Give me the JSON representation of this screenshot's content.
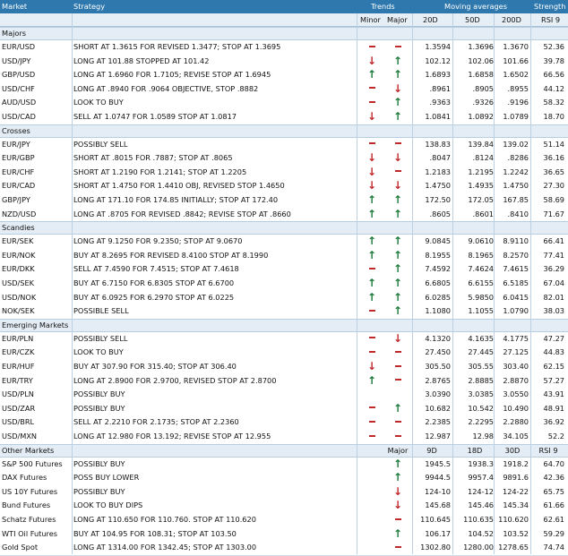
{
  "header": {
    "market": "Market",
    "strategy": "Strategy",
    "trends": "Trends",
    "moving_averages": "Moving averages",
    "strength": "Strength",
    "minor": "Minor",
    "major": "Major",
    "ma1": "20D",
    "ma2": "50D",
    "ma3": "200D",
    "rsi": "RSI 9"
  },
  "colors": {
    "up": "#1a7a3a",
    "down": "#c0292c",
    "header_bg": "#2e78ad",
    "section_bg": "#e4edf5"
  },
  "sections": [
    {
      "name": "Majors",
      "rows": [
        {
          "market": "EUR/USD",
          "strategy": "SHORT AT 1.3615 FOR REVISED 1.3477; STOP AT 1.3695",
          "minor": "flat",
          "major": "flat",
          "v1": "1.3594",
          "v2": "1.3696",
          "v3": "1.3670",
          "rsi": "52.36"
        },
        {
          "market": "USD/JPY",
          "strategy": "LONG AT 101.88 STOPPED AT 101.42",
          "minor": "down",
          "major": "up",
          "v1": "102.12",
          "v2": "102.06",
          "v3": "101.66",
          "rsi": "39.78"
        },
        {
          "market": "GBP/USD",
          "strategy": "LONG AT 1.6960 FOR 1.7105; REVISE STOP AT 1.6945",
          "minor": "up",
          "major": "up",
          "v1": "1.6893",
          "v2": "1.6858",
          "v3": "1.6502",
          "rsi": "66.56"
        },
        {
          "market": "USD/CHF",
          "strategy": "LONG AT .8940 FOR .9064 OBJECTIVE, STOP .8882",
          "minor": "flat",
          "major": "down",
          "v1": ".8961",
          "v2": ".8905",
          "v3": ".8955",
          "rsi": "44.12"
        },
        {
          "market": "AUD/USD",
          "strategy": "LOOK TO BUY",
          "minor": "flat",
          "major": "up",
          "v1": ".9363",
          "v2": ".9326",
          "v3": ".9196",
          "rsi": "58.32"
        },
        {
          "market": "USD/CAD",
          "strategy": "SELL AT 1.0747 FOR 1.0589 STOP AT 1.0817",
          "minor": "down",
          "major": "up",
          "v1": "1.0841",
          "v2": "1.0892",
          "v3": "1.0789",
          "rsi": "18.70"
        }
      ]
    },
    {
      "name": "Crosses",
      "rows": [
        {
          "market": "EUR/JPY",
          "strategy": "POSSIBLY SELL",
          "minor": "flat",
          "major": "flat",
          "v1": "138.83",
          "v2": "139.84",
          "v3": "139.02",
          "rsi": "51.14"
        },
        {
          "market": "EUR/GBP",
          "strategy": "SHORT AT .8015 FOR .7887; STOP AT .8065",
          "minor": "down",
          "major": "down",
          "v1": ".8047",
          "v2": ".8124",
          "v3": ".8286",
          "rsi": "36.16"
        },
        {
          "market": "EUR/CHF",
          "strategy": "SHORT AT 1.2190 FOR 1.2141; STOP AT 1.2205",
          "minor": "down",
          "major": "flat",
          "v1": "1.2183",
          "v2": "1.2195",
          "v3": "1.2242",
          "rsi": "36.65"
        },
        {
          "market": "EUR/CAD",
          "strategy": "SHORT AT 1.4750 FOR 1.4410 OBJ, REVISED STOP 1.4650",
          "minor": "down",
          "major": "down",
          "v1": "1.4750",
          "v2": "1.4935",
          "v3": "1.4750",
          "rsi": "27.30"
        },
        {
          "market": "GBP/JPY",
          "strategy": "LONG AT 171.10 FOR 174.85 INITIALLY; STOP AT 172.40",
          "minor": "up",
          "major": "up",
          "v1": "172.50",
          "v2": "172.05",
          "v3": "167.85",
          "rsi": "58.69"
        },
        {
          "market": "NZD/USD",
          "strategy": "LONG AT .8705 FOR REVISED .8842; REVISE STOP AT .8660",
          "minor": "up",
          "major": "up",
          "v1": ".8605",
          "v2": ".8601",
          "v3": ".8410",
          "rsi": "71.67"
        }
      ]
    },
    {
      "name": "Scandies",
      "rows": [
        {
          "market": "EUR/SEK",
          "strategy": "LONG AT 9.1250 FOR 9.2350; STOP AT 9.0670",
          "minor": "up",
          "major": "up",
          "v1": "9.0845",
          "v2": "9.0610",
          "v3": "8.9110",
          "rsi": "66.41"
        },
        {
          "market": "EUR/NOK",
          "strategy": "BUY AT 8.2695 FOR REVISED 8.4100 STOP AT 8.1990",
          "minor": "up",
          "major": "up",
          "v1": "8.1955",
          "v2": "8.1965",
          "v3": "8.2570",
          "rsi": "77.41"
        },
        {
          "market": "EUR/DKK",
          "strategy": "SELL AT 7.4590 FOR 7.4515; STOP AT 7.4618",
          "minor": "flat",
          "major": "up",
          "v1": "7.4592",
          "v2": "7.4624",
          "v3": "7.4615",
          "rsi": "36.29"
        },
        {
          "market": "USD/SEK",
          "strategy": "BUY AT 6.7150 FOR 6.8305 STOP AT 6.6700",
          "minor": "up",
          "major": "up",
          "v1": "6.6805",
          "v2": "6.6155",
          "v3": "6.5185",
          "rsi": "67.04"
        },
        {
          "market": "USD/NOK",
          "strategy": "BUY AT 6.0925 FOR 6.2970 STOP AT 6.0225",
          "minor": "up",
          "major": "up",
          "v1": "6.0285",
          "v2": "5.9850",
          "v3": "6.0415",
          "rsi": "82.01"
        },
        {
          "market": "NOK/SEK",
          "strategy": "POSSIBLE SELL",
          "minor": "flat",
          "major": "up",
          "v1": "1.1080",
          "v2": "1.1055",
          "v3": "1.0790",
          "rsi": "38.03"
        }
      ]
    },
    {
      "name": "Emerging Markets",
      "rows": [
        {
          "market": "EUR/PLN",
          "strategy": "POSSIBLY SELL",
          "minor": "flat",
          "major": "down",
          "v1": "4.1320",
          "v2": "4.1635",
          "v3": "4.1775",
          "rsi": "47.27"
        },
        {
          "market": "EUR/CZK",
          "strategy": "LOOK TO BUY",
          "minor": "flat",
          "major": "flat",
          "v1": "27.450",
          "v2": "27.445",
          "v3": "27.125",
          "rsi": "44.83"
        },
        {
          "market": "EUR/HUF",
          "strategy": "BUY AT 307.90 FOR 315.40; STOP AT 306.40",
          "minor": "down",
          "major": "flat",
          "v1": "305.50",
          "v2": "305.55",
          "v3": "303.40",
          "rsi": "62.15"
        },
        {
          "market": "EUR/TRY",
          "strategy": "LONG AT 2.8900 FOR 2.9700, REVISED STOP AT 2.8700",
          "minor": "up",
          "major": "flat",
          "v1": "2.8765",
          "v2": "2.8885",
          "v3": "2.8870",
          "rsi": "57.27"
        },
        {
          "market": "USD/PLN",
          "strategy": "POSSIBLY BUY",
          "minor": "",
          "major": "",
          "v1": "3.0390",
          "v2": "3.0385",
          "v3": "3.0550",
          "rsi": "43.91"
        },
        {
          "market": "USD/ZAR",
          "strategy": "POSSIBLY BUY",
          "minor": "flat",
          "major": "up",
          "v1": "10.682",
          "v2": "10.542",
          "v3": "10.490",
          "rsi": "48.91"
        },
        {
          "market": "USD/BRL",
          "strategy": "SELL AT 2.2210 FOR 2.1735; STOP AT 2.2360",
          "minor": "flat",
          "major": "flat",
          "v1": "2.2385",
          "v2": "2.2295",
          "v3": "2.2880",
          "rsi": "36.92"
        },
        {
          "market": "USD/MXN",
          "strategy": "LONG AT 12.980 FOR 13.192; REVISE STOP AT 12.955",
          "minor": "flat",
          "major": "flat",
          "v1": "12.987",
          "v2": "12.98",
          "v3": "34.105",
          "rsi": "52.2"
        }
      ]
    },
    {
      "name": "Other Markets",
      "header": {
        "major": "Major",
        "ma1": "9D",
        "ma2": "18D",
        "ma3": "30D",
        "rsi": "RSI 9"
      },
      "rows": [
        {
          "market": "S&P 500 Futures",
          "strategy": "POSSIBLY BUY",
          "minor": "",
          "major": "up",
          "v1": "1945.5",
          "v2": "1938.3",
          "v3": "1918.2",
          "rsi": "64.70"
        },
        {
          "market": "DAX Futures",
          "strategy": "POSS BUY LOWER",
          "minor": "",
          "major": "up",
          "v1": "9944.5",
          "v2": "9957.4",
          "v3": "9891.6",
          "rsi": "42.36"
        },
        {
          "market": "US 10Y Futures",
          "strategy": "POSSIBLY BUY",
          "minor": "",
          "major": "down",
          "v1": "124-10",
          "v2": "124-12",
          "v3": "124-22",
          "rsi": "65.75"
        },
        {
          "market": "Bund Futures",
          "strategy": "LOOK TO BUY DIPS",
          "minor": "",
          "major": "down",
          "v1": "145.68",
          "v2": "145.46",
          "v3": "145.34",
          "rsi": "61.66"
        },
        {
          "market": "Schatz Futures",
          "strategy": "LONG AT 110.650 FOR 110.760. STOP AT 110.620",
          "minor": "",
          "major": "flat",
          "v1": "110.645",
          "v2": "110.635",
          "v3": "110.620",
          "rsi": "62.61"
        },
        {
          "market": "WTI Oil Futures",
          "strategy": "BUY AT 104.95 FOR 108.31; STOP AT 103.50",
          "minor": "",
          "major": "up",
          "v1": "106.17",
          "v2": "104.52",
          "v3": "103.52",
          "rsi": "59.29"
        },
        {
          "market": "Gold Spot",
          "strategy": "LONG AT 1314.00 FOR 1342.45; STOP AT 1303.00",
          "minor": "",
          "major": "flat",
          "v1": "1302.80",
          "v2": "1280.00",
          "v3": "1278.65",
          "rsi": "74.74"
        }
      ]
    }
  ]
}
